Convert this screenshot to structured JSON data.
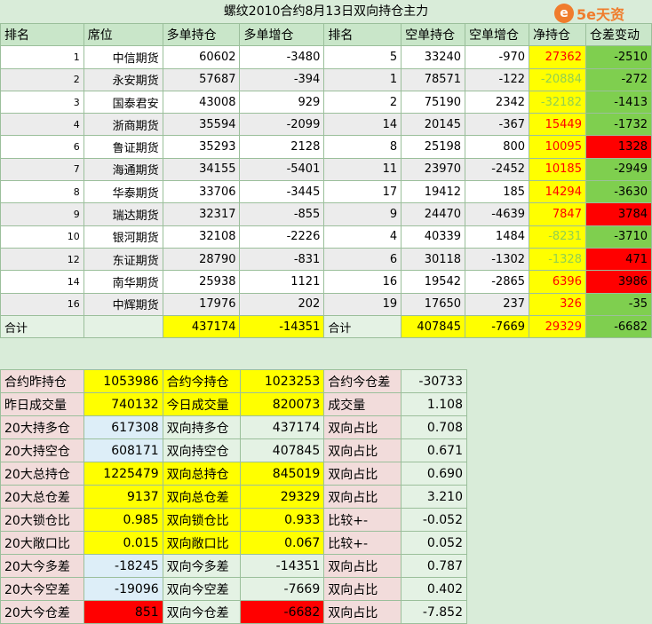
{
  "title": "螺纹2010合约8月13日双向持仓主力",
  "logo": {
    "icon": "e",
    "text": "5e天资"
  },
  "headers": [
    "排名",
    "席位",
    "多单持仓",
    "多单增仓",
    "排名",
    "空单持仓",
    "空单增仓",
    "净持仓",
    "仓差变动"
  ],
  "rows": [
    {
      "rank": "1",
      "name": "中信期货",
      "long": "60602",
      "long_chg": "-3480",
      "rank2": "5",
      "short": "33240",
      "short_chg": "-970",
      "net": "27362",
      "diff": "-2510"
    },
    {
      "rank": "2",
      "name": "永安期货",
      "long": "57687",
      "long_chg": "-394",
      "rank2": "1",
      "short": "78571",
      "short_chg": "-122",
      "net": "-20884",
      "diff": "-272"
    },
    {
      "rank": "3",
      "name": "国泰君安",
      "long": "43008",
      "long_chg": "929",
      "rank2": "2",
      "short": "75190",
      "short_chg": "2342",
      "net": "-32182",
      "diff": "-1413"
    },
    {
      "rank": "4",
      "name": "浙商期货",
      "long": "35594",
      "long_chg": "-2099",
      "rank2": "14",
      "short": "20145",
      "short_chg": "-367",
      "net": "15449",
      "diff": "-1732"
    },
    {
      "rank": "6",
      "name": "鲁证期货",
      "long": "35293",
      "long_chg": "2128",
      "rank2": "8",
      "short": "25198",
      "short_chg": "800",
      "net": "10095",
      "diff": "1328"
    },
    {
      "rank": "7",
      "name": "海通期货",
      "long": "34155",
      "long_chg": "-5401",
      "rank2": "11",
      "short": "23970",
      "short_chg": "-2452",
      "net": "10185",
      "diff": "-2949"
    },
    {
      "rank": "8",
      "name": "华泰期货",
      "long": "33706",
      "long_chg": "-3445",
      "rank2": "17",
      "short": "19412",
      "short_chg": "185",
      "net": "14294",
      "diff": "-3630"
    },
    {
      "rank": "9",
      "name": "瑞达期货",
      "long": "32317",
      "long_chg": "-855",
      "rank2": "9",
      "short": "24470",
      "short_chg": "-4639",
      "net": "7847",
      "diff": "3784"
    },
    {
      "rank": "10",
      "name": "银河期货",
      "long": "32108",
      "long_chg": "-2226",
      "rank2": "4",
      "short": "40339",
      "short_chg": "1484",
      "net": "-8231",
      "diff": "-3710"
    },
    {
      "rank": "12",
      "name": "东证期货",
      "long": "28790",
      "long_chg": "-831",
      "rank2": "6",
      "short": "30118",
      "short_chg": "-1302",
      "net": "-1328",
      "diff": "471"
    },
    {
      "rank": "14",
      "name": "南华期货",
      "long": "25938",
      "long_chg": "1121",
      "rank2": "16",
      "short": "19542",
      "short_chg": "-2865",
      "net": "6396",
      "diff": "3986"
    },
    {
      "rank": "16",
      "name": "中辉期货",
      "long": "17976",
      "long_chg": "202",
      "rank2": "19",
      "short": "17650",
      "short_chg": "237",
      "net": "326",
      "diff": "-35"
    }
  ],
  "total": {
    "label": "合计",
    "long": "437174",
    "long_chg": "-14351",
    "label2": "合计",
    "short": "407845",
    "short_chg": "-7669",
    "net": "29329",
    "diff": "-6682"
  },
  "stats": [
    {
      "l1": "合约昨持仓",
      "v1": "1053986",
      "l2": "合约今持仓",
      "v2": "1023253",
      "l3": "合约今仓差",
      "v3": "-30733"
    },
    {
      "l1": "昨日成交量",
      "v1": "740132",
      "l2": "今日成交量",
      "v2": "820073",
      "l3": "成交量",
      "v3": "1.108"
    },
    {
      "l1": "20大持多仓",
      "v1": "617308",
      "l2": "双向持多仓",
      "v2": "437174",
      "l3": "双向占比",
      "v3": "0.708"
    },
    {
      "l1": "20大持空仓",
      "v1": "608171",
      "l2": "双向持空仓",
      "v2": "407845",
      "l3": "双向占比",
      "v3": "0.671"
    },
    {
      "l1": "20大总持仓",
      "v1": "1225479",
      "l2": "双向总持仓",
      "v2": "845019",
      "l3": "双向占比",
      "v3": "0.690"
    },
    {
      "l1": "20大总仓差",
      "v1": "9137",
      "l2": "双向总仓差",
      "v2": "29329",
      "l3": "双向占比",
      "v3": "3.210"
    },
    {
      "l1": "20大锁仓比",
      "v1": "0.985",
      "l2": "双向锁仓比",
      "v2": "0.933",
      "l3": "比较+-",
      "v3": "-0.052"
    },
    {
      "l1": "20大敞口比",
      "v1": "0.015",
      "l2": "双向敞口比",
      "v2": "0.067",
      "l3": "比较+-",
      "v3": "0.052"
    },
    {
      "l1": "20大今多差",
      "v1": "-18245",
      "l2": "双向今多差",
      "v2": "-14351",
      "l3": "双向占比",
      "v3": "0.787"
    },
    {
      "l1": "20大今空差",
      "v1": "-19096",
      "l2": "双向今空差",
      "v2": "-7669",
      "l3": "双向占比",
      "v3": "0.402"
    },
    {
      "l1": "20大今仓差",
      "v1": "851",
      "l2": "双向今仓差",
      "v2": "-6682",
      "l3": "双向占比",
      "v3": "-7.852"
    }
  ],
  "colors": {
    "positive_net": "#ff0000",
    "negative_net": "#92d050",
    "highlight": "#ffff00",
    "diff_up": "#ff0000",
    "diff_down": "#7fcf4f"
  }
}
